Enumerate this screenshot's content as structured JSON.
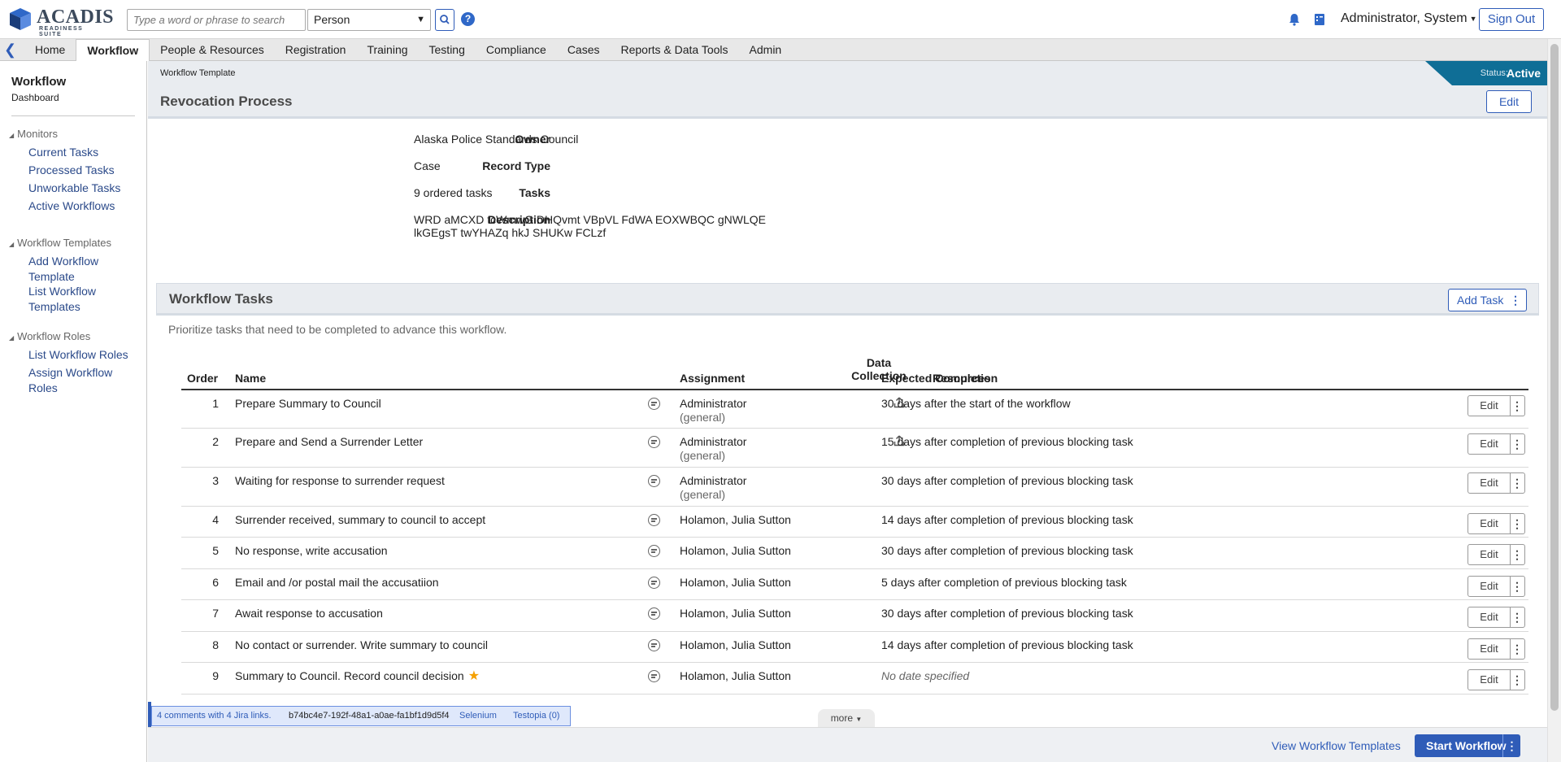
{
  "header": {
    "logo_text": "ACADIS",
    "logo_sub": "READINESS SUITE",
    "search_placeholder": "Type a word or phrase to search",
    "search_scope": "Person",
    "help_label": "?",
    "user_name": "Administrator, System",
    "sign_out_label": "Sign Out"
  },
  "nav": {
    "tabs": [
      {
        "label": "Home",
        "active": false
      },
      {
        "label": "Workflow",
        "active": true
      },
      {
        "label": "People & Resources",
        "active": false
      },
      {
        "label": "Registration",
        "active": false
      },
      {
        "label": "Training",
        "active": false
      },
      {
        "label": "Testing",
        "active": false
      },
      {
        "label": "Compliance",
        "active": false
      },
      {
        "label": "Cases",
        "active": false
      },
      {
        "label": "Reports & Data Tools",
        "active": false
      },
      {
        "label": "Admin",
        "active": false
      }
    ]
  },
  "sidebar": {
    "title": "Workflow",
    "subtitle": "Dashboard",
    "groups": [
      {
        "label": "Monitors",
        "items": [
          "Current Tasks",
          "Processed Tasks",
          "Unworkable Tasks",
          "Active Workflows"
        ]
      },
      {
        "label": "Workflow Templates",
        "items": [
          "Add Workflow Template",
          "List Workflow Templates"
        ]
      },
      {
        "label": "Workflow Roles",
        "items": [
          "List Workflow Roles",
          "Assign Workflow Roles"
        ]
      }
    ]
  },
  "page": {
    "kicker": "Workflow Template",
    "title": "Revocation Process",
    "status_label": "Status:",
    "status_value": "Active",
    "edit_label": "Edit"
  },
  "properties": [
    {
      "label": "Owner",
      "value": "Alaska Police Standards Council"
    },
    {
      "label": "Record Type",
      "value": "Case"
    },
    {
      "label": "Tasks",
      "value": "9 ordered tasks"
    },
    {
      "label": "Description",
      "value": "WRD aMCXD tcWmwG DHQvmt VBpVL FdWA EOXWBQC gNWLQE lkGEgsT twYHAZq hkJ SHUKw FCLzf"
    }
  ],
  "tasks": {
    "title": "Workflow Tasks",
    "add_label": "Add Task",
    "hint": "Prioritize tasks that need to be completed to advance this workflow.",
    "columns": {
      "order": "Order",
      "name": "Name",
      "assignment": "Assignment",
      "data_collection": "Data Collection",
      "resources": "Resources",
      "expected": "Expected Completion"
    },
    "row_edit_label": "Edit",
    "rows": [
      {
        "order": "1",
        "name": "Prepare Summary to Council",
        "assignment": "Administrator",
        "assignment_sub": "(general)",
        "upload": true,
        "expected": "30 days after the start of the workflow",
        "star": false
      },
      {
        "order": "2",
        "name": "Prepare and Send a Surrender Letter",
        "assignment": "Administrator",
        "assignment_sub": "(general)",
        "upload": true,
        "expected": "15 days after completion of previous blocking task",
        "star": false
      },
      {
        "order": "3",
        "name": "Waiting for response to surrender request",
        "assignment": "Administrator",
        "assignment_sub": "(general)",
        "upload": false,
        "expected": "30 days after completion of previous blocking task",
        "star": false
      },
      {
        "order": "4",
        "name": "Surrender received, summary to council to accept",
        "assignment": "Holamon, Julia Sutton",
        "assignment_sub": "",
        "upload": false,
        "expected": "14 days after completion of previous blocking task",
        "star": false
      },
      {
        "order": "5",
        "name": "No response, write accusation",
        "assignment": "Holamon, Julia Sutton",
        "assignment_sub": "",
        "upload": false,
        "expected": "30 days after completion of previous blocking task",
        "star": false
      },
      {
        "order": "6",
        "name": "Email and /or postal mail the accusatiion",
        "assignment": "Holamon, Julia Sutton",
        "assignment_sub": "",
        "upload": false,
        "expected": "5 days after completion of previous blocking task",
        "star": false
      },
      {
        "order": "7",
        "name": "Await response to accusation",
        "assignment": "Holamon, Julia Sutton",
        "assignment_sub": "",
        "upload": false,
        "expected": "30 days after completion of previous blocking task",
        "star": false
      },
      {
        "order": "8",
        "name": "No contact or surrender. Write summary to council",
        "assignment": "Holamon, Julia Sutton",
        "assignment_sub": "",
        "upload": false,
        "expected": "14 days after completion of previous blocking task",
        "star": false
      },
      {
        "order": "9",
        "name": "Summary to Council. Record council decision",
        "assignment": "Holamon, Julia Sutton",
        "assignment_sub": "",
        "upload": false,
        "expected": "No date specified",
        "star": true
      }
    ]
  },
  "devbar": {
    "comments": "4 comments with 4 Jira links.",
    "hash": "b74bc4e7-192f-48a1-a0ae-fa1bf1d9d5f4",
    "selenium": "Selenium",
    "testopia": "Testopia (0)"
  },
  "footer": {
    "more_label": "more",
    "view_templates_label": "View Workflow Templates",
    "start_label": "Start Workflow"
  },
  "colors": {
    "accent": "#2f5cb8",
    "status_flag": "#0f6e96",
    "star": "#f5a000"
  }
}
